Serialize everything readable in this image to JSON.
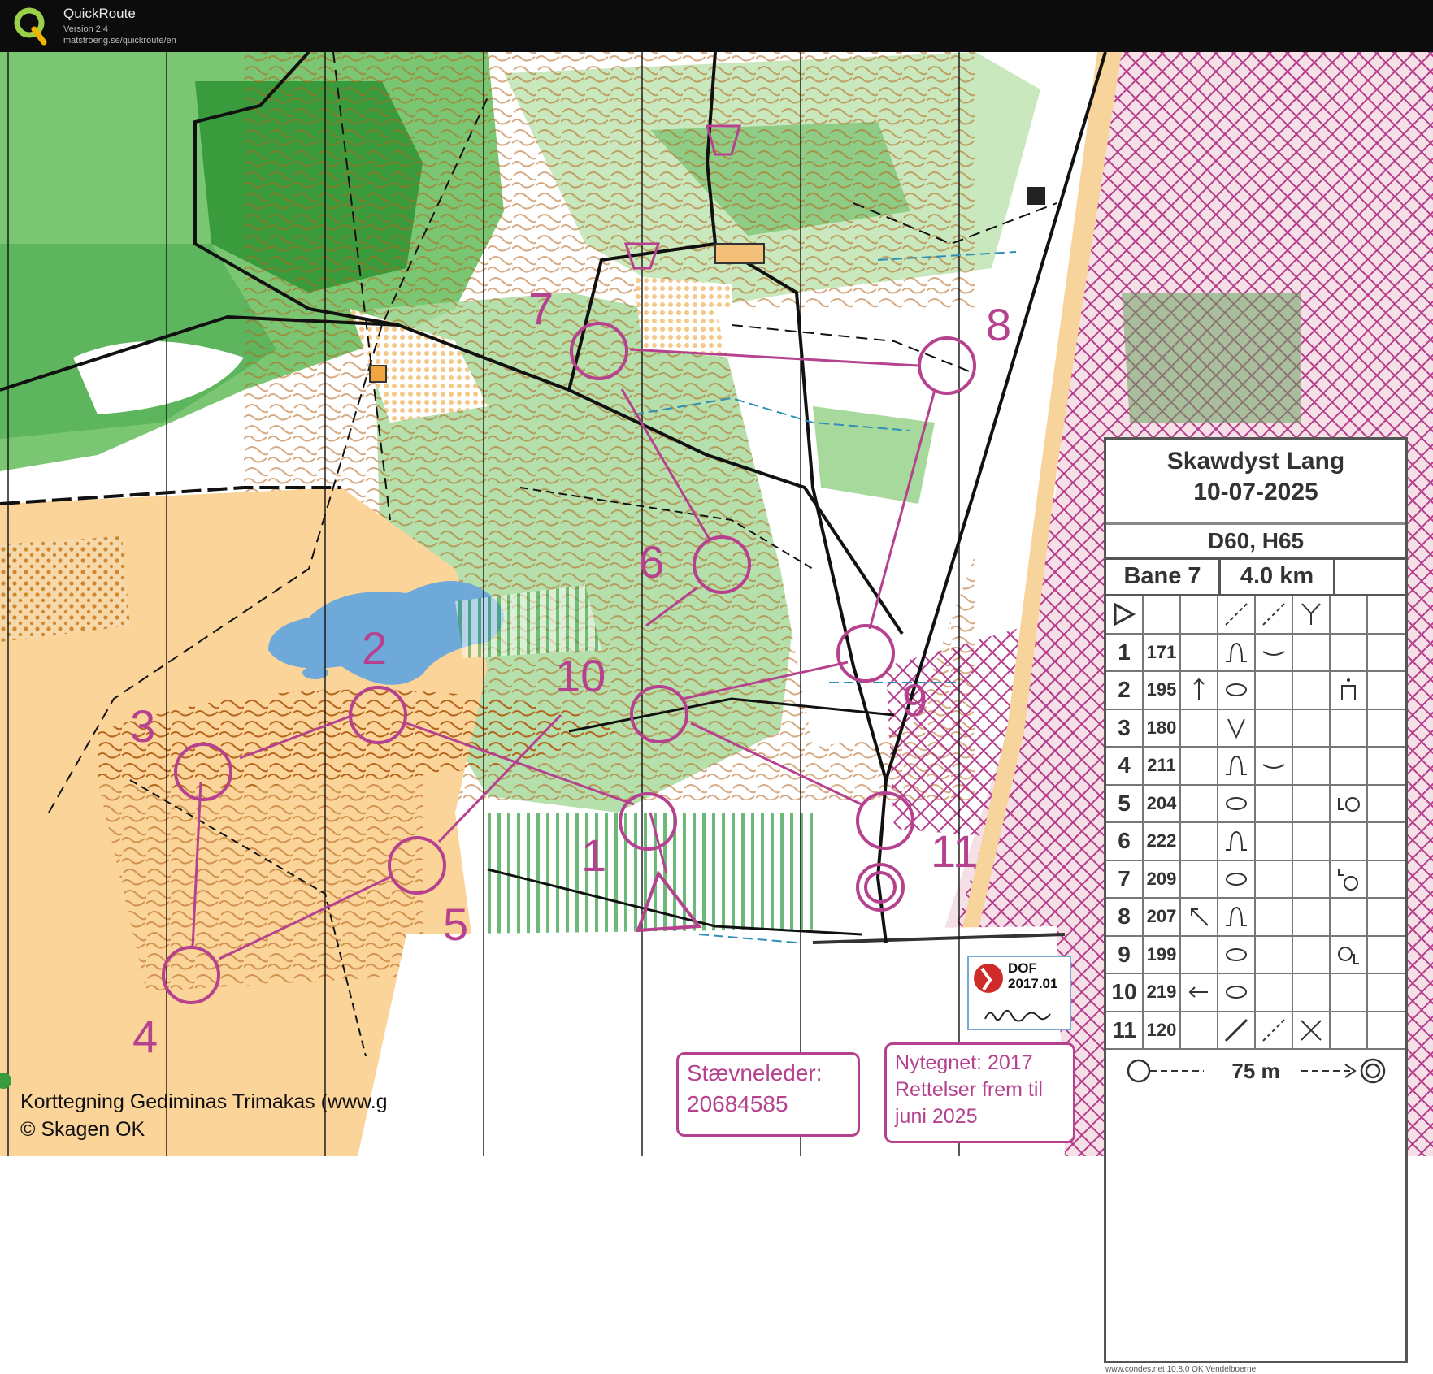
{
  "app": {
    "title": "QuickRoute",
    "version": "Version 2.4",
    "url": "matstroeng.se/quickroute/en"
  },
  "map": {
    "course_numbers": [
      {
        "n": "1",
        "name": "control-number-1"
      },
      {
        "n": "2",
        "name": "control-number-2"
      },
      {
        "n": "3",
        "name": "control-number-3"
      },
      {
        "n": "4",
        "name": "control-number-4"
      },
      {
        "n": "5",
        "name": "control-number-5"
      },
      {
        "n": "6",
        "name": "control-number-6"
      },
      {
        "n": "7",
        "name": "control-number-7"
      },
      {
        "n": "8",
        "name": "control-number-8"
      },
      {
        "n": "9",
        "name": "control-number-9"
      },
      {
        "n": "10",
        "name": "control-number-10"
      },
      {
        "n": "11",
        "name": "control-number-11"
      }
    ],
    "course_color": "#b6428f",
    "credit_line1": "Korttegning Gediminas Trimakas (www.g",
    "credit_line2": "© Skagen OK",
    "organizer_label": "Stævneleder:",
    "organizer_phone": "20684585",
    "revision_line1": "Nytegnet: 2017",
    "revision_line2": "Rettelser frem til",
    "revision_line3": "juni 2025",
    "dof_line1": "DOF",
    "dof_line2": "2017.01"
  },
  "description": {
    "title": "Skawdyst Lang",
    "date": "10-07-2025",
    "classes": "D60, H65",
    "course": "Bane 7",
    "length": "4.0 km",
    "controls": [
      {
        "num": "1",
        "code": "171"
      },
      {
        "num": "2",
        "code": "195"
      },
      {
        "num": "3",
        "code": "180"
      },
      {
        "num": "4",
        "code": "211"
      },
      {
        "num": "5",
        "code": "204"
      },
      {
        "num": "6",
        "code": "222"
      },
      {
        "num": "7",
        "code": "209"
      },
      {
        "num": "8",
        "code": "207"
      },
      {
        "num": "9",
        "code": "199"
      },
      {
        "num": "10",
        "code": "219"
      },
      {
        "num": "11",
        "code": "120"
      }
    ],
    "finish_distance": "75 m",
    "software": "www.condes.net 10.8.0 OK Vendelboerne"
  }
}
